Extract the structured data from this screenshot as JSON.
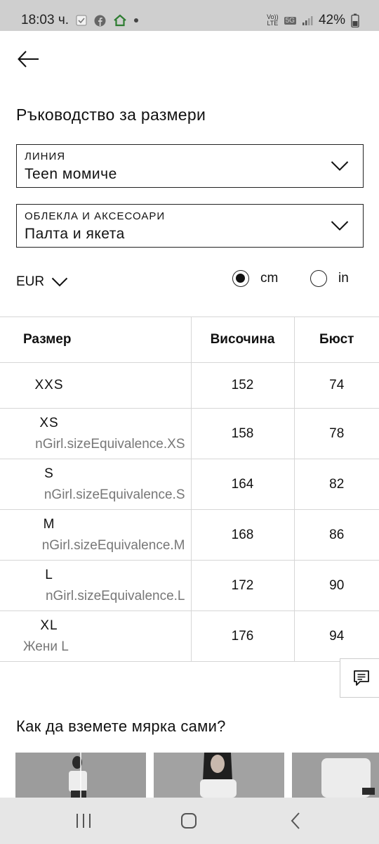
{
  "status_bar": {
    "time": "18:03 ч.",
    "volte_top": "Vo))",
    "volte_bottom": "LTE",
    "network": "5G",
    "battery": "42%"
  },
  "page": {
    "title": "Ръководство за размери"
  },
  "line_select": {
    "caption": "ЛИНИЯ",
    "value": "Teen момиче"
  },
  "category_select": {
    "caption": "ОБЛЕКЛА И АКСЕСОАРИ",
    "value": "Палта и якета"
  },
  "currency": {
    "value": "EUR"
  },
  "units": {
    "cm_label": "cm",
    "in_label": "in",
    "selected": "cm"
  },
  "table": {
    "headers": {
      "size": "Размер",
      "height": "Височина",
      "bust": "Бюст"
    },
    "rows": [
      {
        "size": "XXS",
        "equivalence": "",
        "height": "152",
        "bust": "74"
      },
      {
        "size": "XS",
        "equivalence": "nGirl.sizeEquivalence.XS",
        "height": "158",
        "bust": "78"
      },
      {
        "size": "S",
        "equivalence": "nGirl.sizeEquivalence.S",
        "height": "164",
        "bust": "82"
      },
      {
        "size": "M",
        "equivalence": "nGirl.sizeEquivalence.M",
        "height": "168",
        "bust": "86"
      },
      {
        "size": "L",
        "equivalence": "nGirl.sizeEquivalence.L",
        "height": "172",
        "bust": "90"
      },
      {
        "size": "XL",
        "equivalence": "Жени L",
        "height": "176",
        "bust": "94"
      }
    ]
  },
  "how_to_measure": {
    "title": "Как да вземете мярка сами?"
  },
  "colors": {
    "status_bar_bg": "#cfcfcf",
    "nav_bar_bg": "#e6e6e6",
    "border": "#222222",
    "table_line": "#d6d6d6",
    "muted_text": "#777777"
  }
}
